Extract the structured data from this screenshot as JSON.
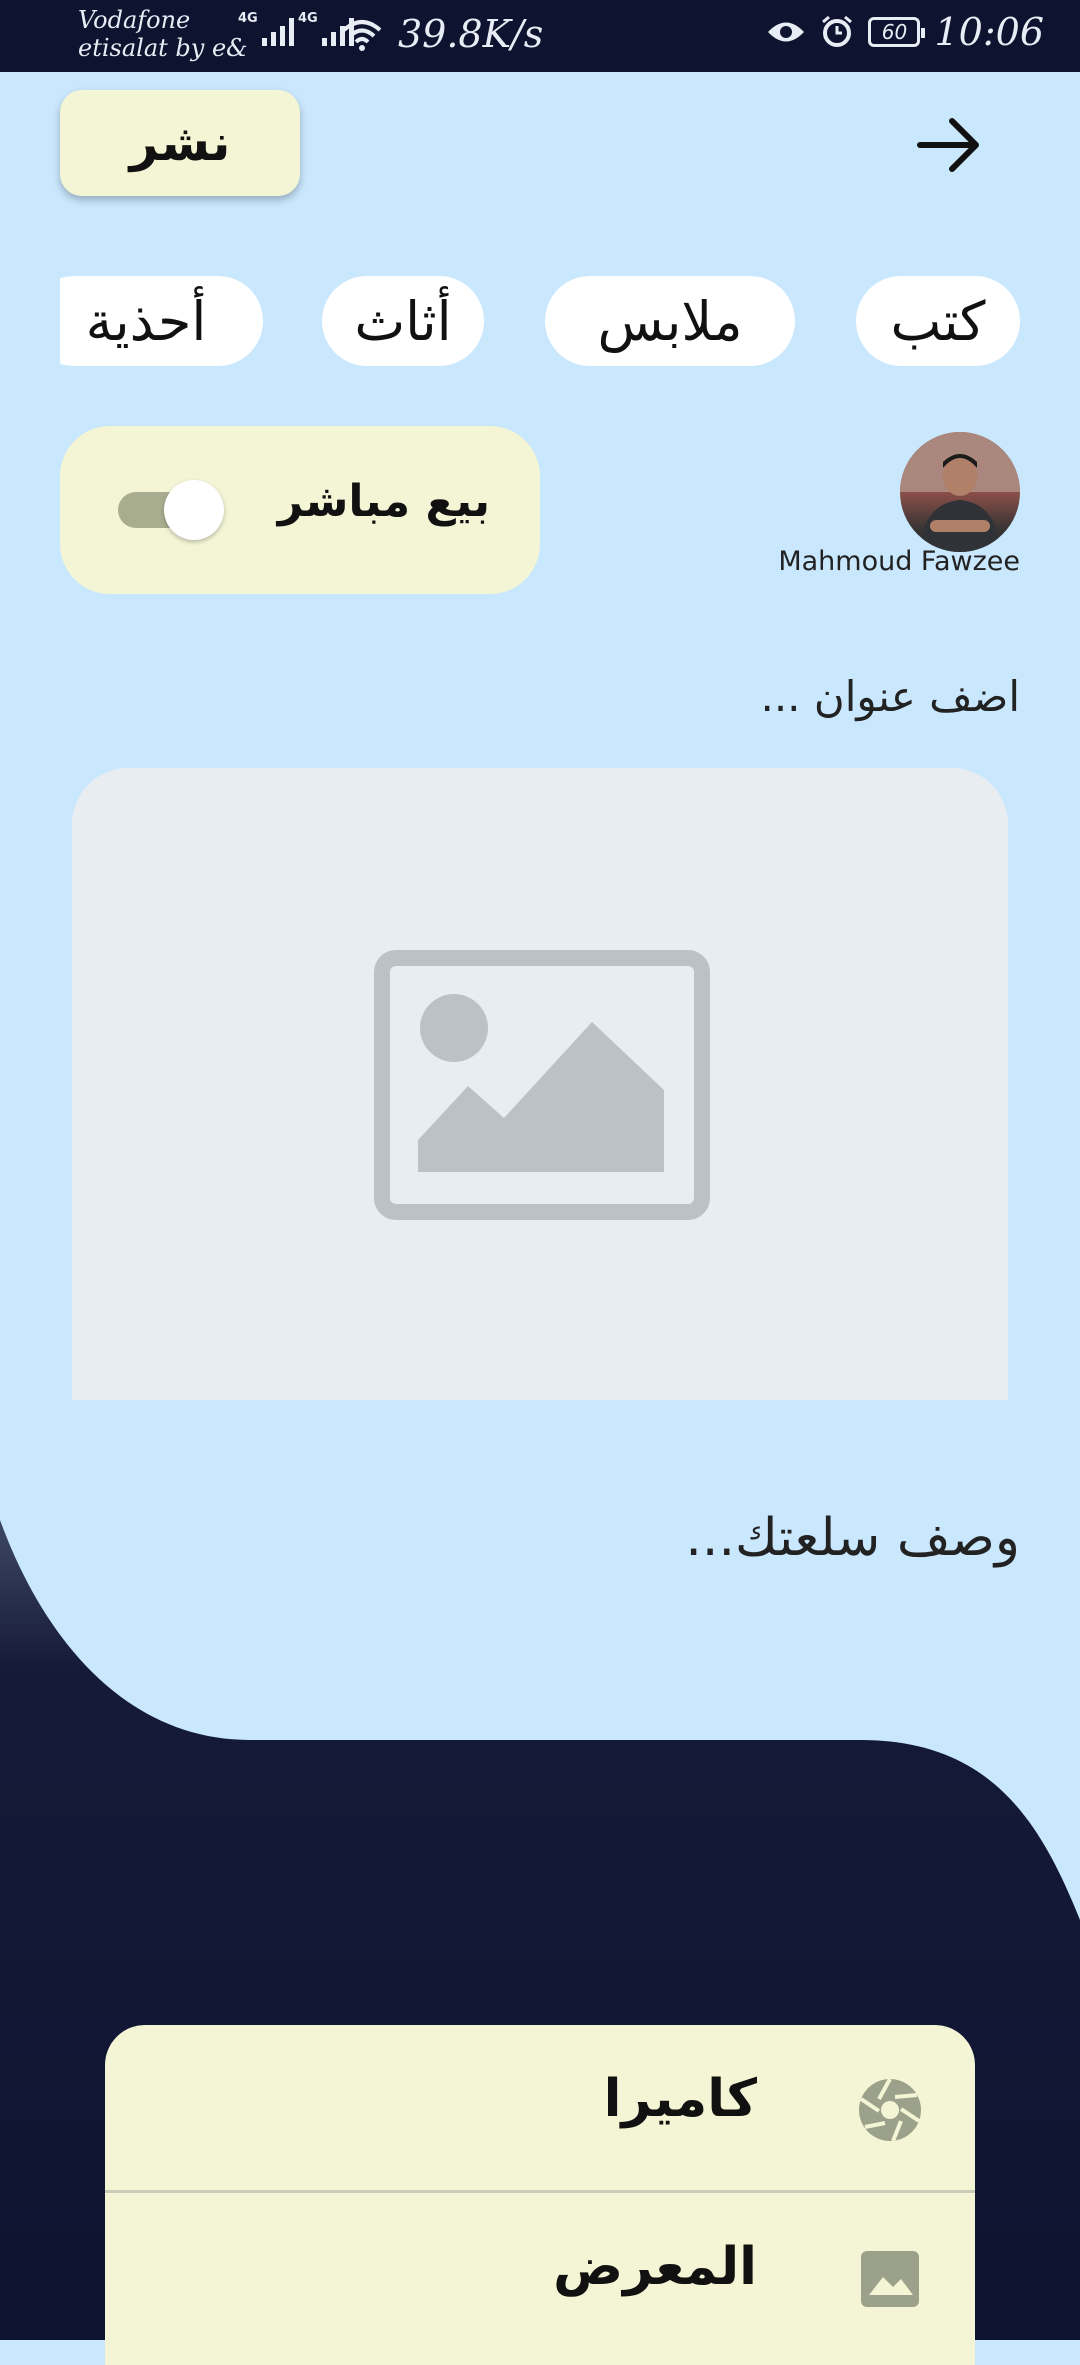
{
  "status_bar": {
    "carrier_line1": "Vodafone",
    "carrier_line2": "etisalat by e&",
    "network1": "4G",
    "network2": "4G",
    "speed": "39.8K/s",
    "battery": "60",
    "time": "10:06"
  },
  "header": {
    "publish_label": "نشر",
    "back_icon": "arrow-forward-icon"
  },
  "categories": [
    "كتب",
    "ملابس",
    "أثاث",
    "أحذية"
  ],
  "seller": {
    "name": "Mahmoud Fawzee",
    "direct_sale_label": "بيع مباشر",
    "direct_sale_enabled": false
  },
  "form": {
    "title_placeholder": "اضف عنوان ...",
    "image_placeholder_icon": "image-placeholder-icon",
    "description_placeholder": "وصف سلعتك..."
  },
  "image_source_sheet": {
    "options": [
      {
        "label": "كاميرا",
        "icon": "camera-aperture-icon"
      },
      {
        "label": "المعرض",
        "icon": "gallery-icon"
      }
    ]
  },
  "colors": {
    "background": "#c9e7fd",
    "dark": "#0e1430",
    "card": "#f3f5d5",
    "image_box": "#e8edf1"
  }
}
